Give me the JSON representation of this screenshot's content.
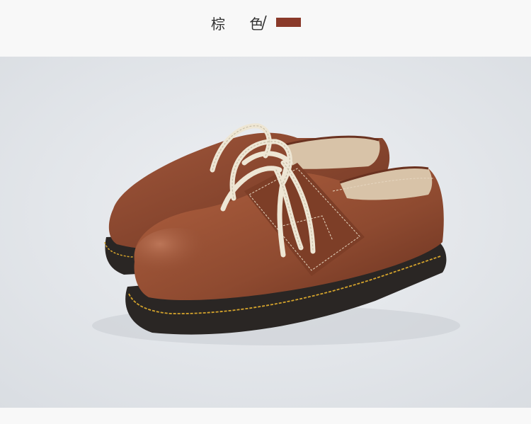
{
  "header": {
    "color_label": "棕 色",
    "separator": "/",
    "swatch_color": "#8a3a2a"
  },
  "photo": {
    "subject": "brown-leather-lace-up-shoes",
    "background_color": "#e3e6ea",
    "leather_color": "#8e4a30",
    "lace_color": "#eee6d4",
    "sole_color": "#2a2624",
    "stitch_color": "#d4a32c"
  }
}
